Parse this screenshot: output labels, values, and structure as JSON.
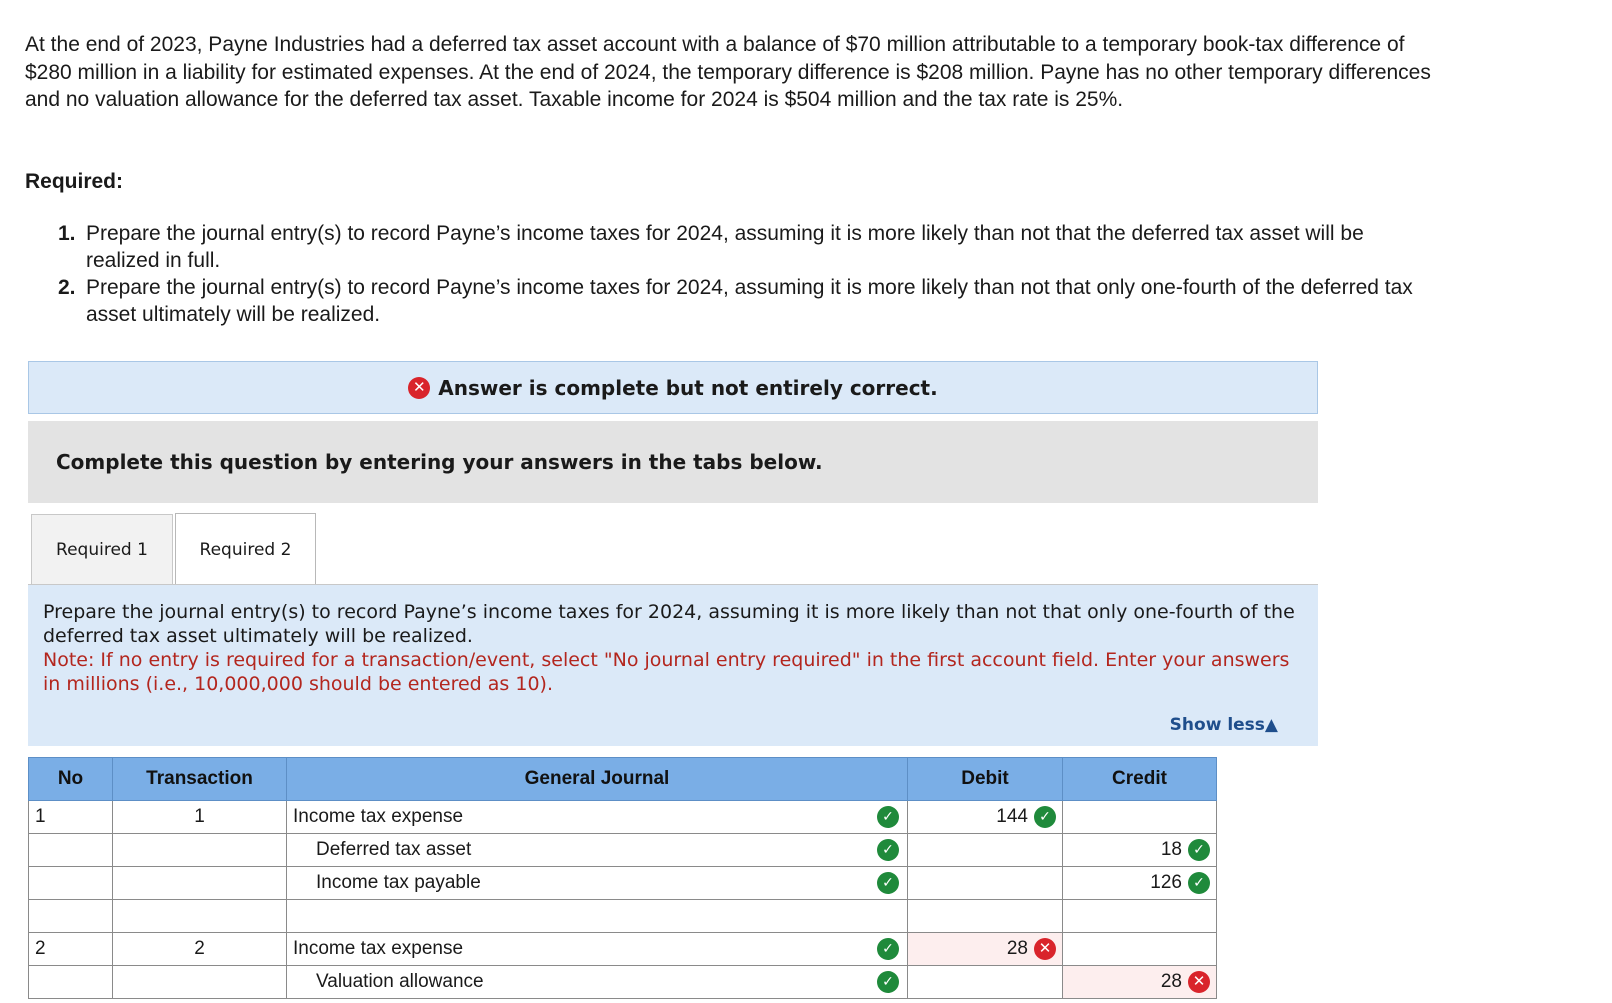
{
  "problem_text": "At the end of 2023, Payne Industries had a deferred tax asset account with a balance of $70 million attributable to a temporary book-tax difference of $280 million in a liability for estimated expenses. At the end of 2024, the temporary difference is $208 million. Payne has no other temporary differences and no valuation allowance for the deferred tax asset. Taxable income for 2024 is $504 million and the tax rate is 25%.",
  "required_heading": "Required:",
  "requirements": [
    {
      "number": "1.",
      "text": "Prepare the journal entry(s) to record Payne’s income taxes for 2024, assuming it is more likely than not that the deferred tax asset will be realized in full."
    },
    {
      "number": "2.",
      "text": "Prepare the journal entry(s) to record Payne’s income taxes for 2024, assuming it is more likely than not that only one-fourth of the deferred tax asset ultimately will be realized."
    }
  ],
  "answer_banner": "Answer is complete but not entirely correct.",
  "complete_prompt": "Complete this question by entering your answers in the tabs below.",
  "tabs": [
    {
      "label": "Required 1",
      "active": false
    },
    {
      "label": "Required 2",
      "active": true
    }
  ],
  "instructions": {
    "text": "Prepare the journal entry(s) to record Payne’s income taxes for 2024, assuming it is more likely than not that only one-fourth of the deferred tax asset ultimately will be realized.",
    "note": "Note: If no entry is required for a transaction/event, select \"No journal entry required\" in the first account field. Enter your answers in millions (i.e., 10,000,000 should be entered as 10).",
    "show_less": "Show less▲"
  },
  "journal": {
    "headers": {
      "no": "No",
      "transaction": "Transaction",
      "general_journal": "General Journal",
      "debit": "Debit",
      "credit": "Credit"
    },
    "rows": [
      {
        "no": "1",
        "transaction": "1",
        "account": "Income tax expense",
        "debit": "144",
        "credit": ""
      },
      {
        "no": "",
        "transaction": "",
        "account": "Deferred tax asset",
        "debit": "",
        "credit": "18"
      },
      {
        "no": "",
        "transaction": "",
        "account": "Income tax payable",
        "debit": "",
        "credit": "126"
      },
      {
        "no": "",
        "transaction": "",
        "account": "",
        "debit": "",
        "credit": ""
      },
      {
        "no": "2",
        "transaction": "2",
        "account": "Income tax expense",
        "debit": "28",
        "credit": ""
      },
      {
        "no": "",
        "transaction": "",
        "account": "Valuation allowance",
        "debit": "",
        "credit": "28"
      }
    ]
  },
  "colors": {
    "correct": "#1f8a3b",
    "incorrect": "#d9242b",
    "header_blue": "#7aaee6",
    "panel_blue": "#dbe9f8",
    "note_red": "#b3261e"
  }
}
